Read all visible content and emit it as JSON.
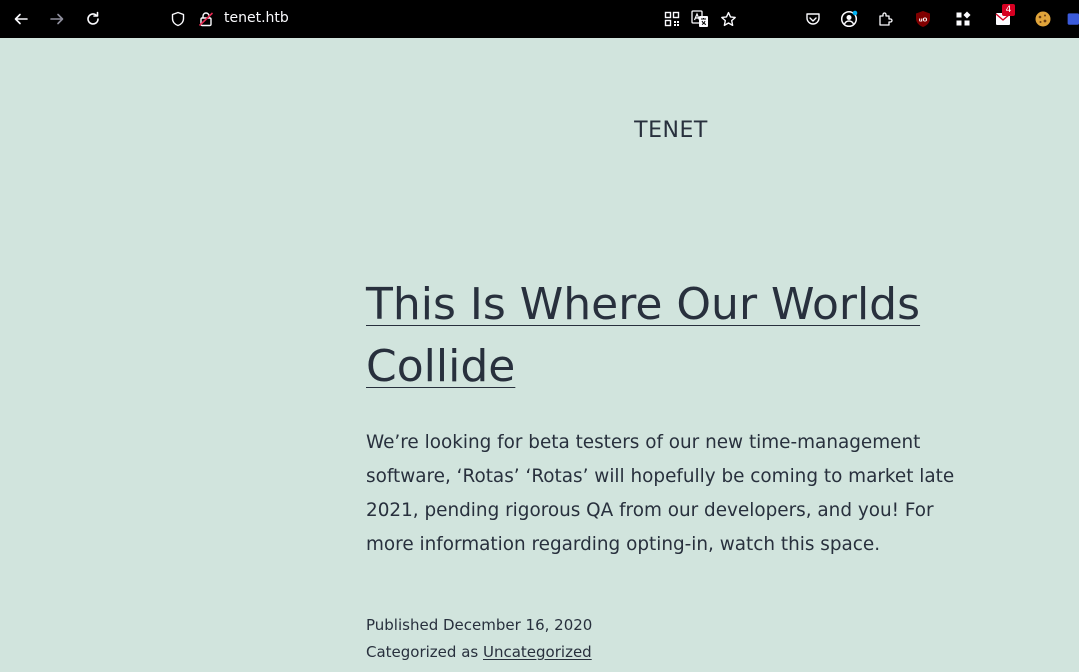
{
  "browser": {
    "url": "tenet.htb",
    "extension_badge_count": "4",
    "colors": {
      "toolbar_bg": "#000000",
      "icon": "#fbfbfe",
      "badge": "#d70022"
    }
  },
  "site": {
    "title": "TENET",
    "background": "#d1e4dd",
    "text_color": "#28303d"
  },
  "post": {
    "title": "This Is Where Our Worlds Collide",
    "body": "We’re looking for beta testers of our new time-management software, ‘Rotas’ ‘Rotas’ will hopefully be coming to market late 2021, pending rigorous QA from our developers, and you! For more information regarding opting-in, watch this space.",
    "published_label": "Published",
    "published_date": "December 16, 2020",
    "category_label": "Categorized as",
    "category": "Uncategorized"
  }
}
